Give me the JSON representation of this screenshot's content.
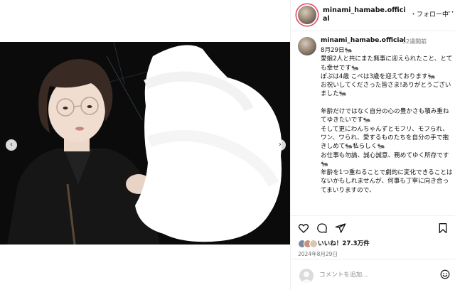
{
  "header": {
    "username": "minami_hamabe.official",
    "follow_label": "・フォロー中",
    "more_label": "···"
  },
  "caption": {
    "username": "minami_hamabe.official",
    "time_ago": "52週間前",
    "text": "8月29日🐜\n愛娘2人と共にまた無事に迎えられたこと、とても幸せです🐜\nぽぷは4歳 こぺは3歳を迎えております🐜\nお祝いしてくださった皆さま!ありがとうございました🐜\n\n年齢だけではなく自分の心の豊かさも積み重ねてゆきたいです🐜\nそして更にわんちゃんずとモフリ、モフられ、ワン、ワられ、愛するものたちを自分の手で抱きしめて🐜私らしく🐜\nお仕事も勿論、誠心誠意、務めてゆく所存です🐜\n年齢を1つ重ねることで劇的に変化できることはないかもしれませんが、何事も丁寧に向き合ってまいりますので、"
  },
  "actions": {
    "likes_text": "いいね！27.3万件",
    "date": "2024年8月29日"
  },
  "comment": {
    "placeholder": "コメントを追加..."
  },
  "icons": {
    "like": "heart-icon",
    "comment": "comment-icon",
    "share": "share-icon",
    "save": "bookmark-icon",
    "prev": "chevron-left-icon",
    "next": "chevron-right-icon",
    "emoji": "emoji-icon"
  },
  "colors": {
    "story_ring": "#e4405f",
    "photo_background": "#0b0b0c",
    "secondary_text": "#737373"
  }
}
